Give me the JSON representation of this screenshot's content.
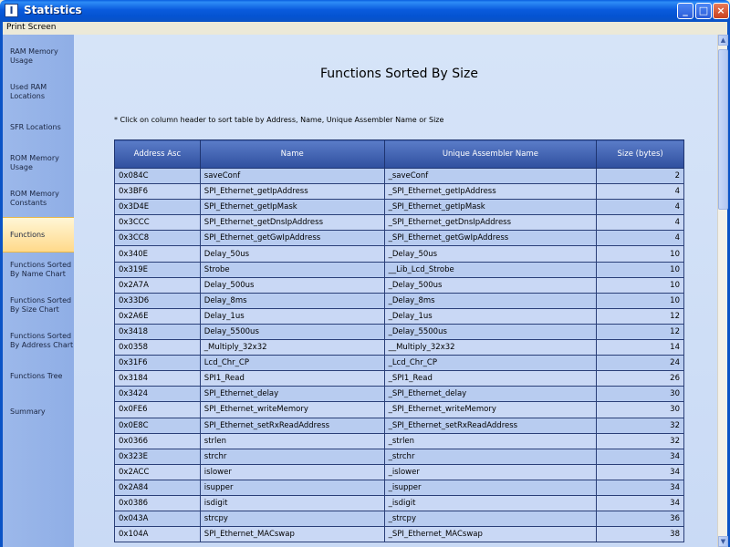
{
  "window": {
    "title": "Statistics",
    "icon_glyph": "I",
    "buttons": {
      "minimize": "_",
      "maximize": "□",
      "close": "×"
    }
  },
  "menu": {
    "print_screen": "Print Screen"
  },
  "sidebar": {
    "items": [
      {
        "label": "RAM Memory Usage"
      },
      {
        "label": "Used RAM Locations"
      },
      {
        "label": "SFR Locations"
      },
      {
        "label": "ROM Memory Usage"
      },
      {
        "label": "ROM Memory Constants"
      },
      {
        "label": "Functions",
        "active": true
      },
      {
        "label": "Functions Sorted By Name Chart"
      },
      {
        "label": "Functions Sorted By Size Chart"
      },
      {
        "label": "Functions Sorted By Address Chart"
      },
      {
        "label": "Functions Tree"
      },
      {
        "label": "Summary"
      }
    ]
  },
  "main": {
    "title": "Functions Sorted By Size",
    "hint": "* Click on column header to sort table by Address, Name, Unique Assembler Name or Size",
    "table": {
      "headers": [
        "Address Asc",
        "Name",
        "Unique Assembler Name",
        "Size (bytes)"
      ],
      "rows": [
        [
          "0x084C",
          "saveConf",
          "_saveConf",
          "2"
        ],
        [
          "0x3BF6",
          "SPI_Ethernet_getIpAddress",
          "_SPI_Ethernet_getIpAddress",
          "4"
        ],
        [
          "0x3D4E",
          "SPI_Ethernet_getIpMask",
          "_SPI_Ethernet_getIpMask",
          "4"
        ],
        [
          "0x3CCC",
          "SPI_Ethernet_getDnsIpAddress",
          "_SPI_Ethernet_getDnsIpAddress",
          "4"
        ],
        [
          "0x3CC8",
          "SPI_Ethernet_getGwIpAddress",
          "_SPI_Ethernet_getGwIpAddress",
          "4"
        ],
        [
          "0x340E",
          "Delay_50us",
          "_Delay_50us",
          "10"
        ],
        [
          "0x319E",
          "Strobe",
          "__Lib_Lcd_Strobe",
          "10"
        ],
        [
          "0x2A7A",
          "Delay_500us",
          "_Delay_500us",
          "10"
        ],
        [
          "0x33D6",
          "Delay_8ms",
          "_Delay_8ms",
          "10"
        ],
        [
          "0x2A6E",
          "Delay_1us",
          "_Delay_1us",
          "12"
        ],
        [
          "0x3418",
          "Delay_5500us",
          "_Delay_5500us",
          "12"
        ],
        [
          "0x0358",
          "_Multiply_32x32",
          "__Multiply_32x32",
          "14"
        ],
        [
          "0x31F6",
          "Lcd_Chr_CP",
          "_Lcd_Chr_CP",
          "24"
        ],
        [
          "0x3184",
          "SPI1_Read",
          "_SPI1_Read",
          "26"
        ],
        [
          "0x3424",
          "SPI_Ethernet_delay",
          "_SPI_Ethernet_delay",
          "30"
        ],
        [
          "0x0FE6",
          "SPI_Ethernet_writeMemory",
          "_SPI_Ethernet_writeMemory",
          "30"
        ],
        [
          "0x0E8C",
          "SPI_Ethernet_setRxReadAddress",
          "_SPI_Ethernet_setRxReadAddress",
          "32"
        ],
        [
          "0x0366",
          "strlen",
          "_strlen",
          "32"
        ],
        [
          "0x323E",
          "strchr",
          "_strchr",
          "34"
        ],
        [
          "0x2ACC",
          "islower",
          "_islower",
          "34"
        ],
        [
          "0x2A84",
          "isupper",
          "_isupper",
          "34"
        ],
        [
          "0x0386",
          "isdigit",
          "_isdigit",
          "34"
        ],
        [
          "0x043A",
          "strcpy",
          "_strcpy",
          "36"
        ],
        [
          "0x104A",
          "SPI_Ethernet_MACswap",
          "_SPI_Ethernet_MACswap",
          "38"
        ]
      ]
    }
  },
  "colors": {
    "titlebar": "#0A53C6",
    "sidebar": "#9CB8EA",
    "active_item": "#FFD98A",
    "table_header": "#2F4F9E",
    "row": "#B8CCF0"
  }
}
